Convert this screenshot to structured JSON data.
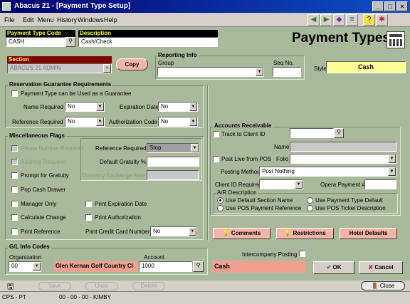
{
  "window": {
    "title": "Abacus 21 - [Payment Type Setup]",
    "min": "_",
    "max": "□",
    "close": "×"
  },
  "menu": [
    "File",
    "Edit",
    "Menu",
    "History",
    "Windows",
    "Help"
  ],
  "toolbar_icons": [
    "back-arrow-icon",
    "forward-arrow-icon",
    "diamond-icon",
    "stack-icon",
    "help-icon",
    "user-exit-icon"
  ],
  "header": {
    "payment_type_code_label": "Payment Type Code",
    "payment_type_code": "CASH",
    "description_label": "Description",
    "description": "Cash/Check",
    "big_title": "Payment Types"
  },
  "section": {
    "label": "Section",
    "value": "ABACUS 21 ADMIN",
    "copy": "Copy"
  },
  "reporting": {
    "title": "Reporting Info",
    "group_label": "Group",
    "group_value": "",
    "seq_label": "Seq No.",
    "seq_value": "",
    "style_label": "Style",
    "style_value": "Cash"
  },
  "guarantee": {
    "title": "Reservation Guarantee Requirements",
    "can_be_used": "Payment Type can be Used as a Guarantee",
    "name_required_label": "Name Required",
    "name_required": "No",
    "expiration_date_label": "Expiration Date",
    "expiration_date": "No",
    "reference_required_label": "Reference Required",
    "reference_required": "No",
    "auth_code_label": "Authorization Code",
    "auth_code": "No"
  },
  "misc": {
    "title": "Miscellaneous Flags",
    "phone_required": "Phone Number Required",
    "address_required": "Address Required",
    "prompt_gratuity": "Prompt for Gratuity",
    "pop_cash_drawer": "Pop Cash Drawer",
    "manager_only": "Manager Only",
    "calculate_change": "Calculate Change",
    "print_reference": "Print Reference",
    "reference_required_label": "Reference Required",
    "reference_required": "Stop",
    "default_gratuity_label": "Default Gratuity %",
    "default_gratuity": "",
    "currency_exchange_label": "Currency Exchange Rate",
    "currency_exchange": "",
    "print_expiration": "Print Expiration Date",
    "print_authorization": "Print Authorization",
    "print_cc_label": "Print Credit Card Number",
    "print_cc": "No"
  },
  "ar": {
    "title": "Accounts Receivable",
    "track_client": "Track to Client ID",
    "track_client_value": "",
    "name_label": "Name",
    "name_value": "",
    "post_live": "Post Live from POS",
    "folio_label": "Folio",
    "folio_value": "",
    "posting_method_label": "Posting Method",
    "posting_method": "Post Nothing",
    "client_id_required_label": "Client ID Required",
    "client_id_required": "",
    "opera_payment_label": "Opera Payment #",
    "opera_payment": "",
    "ar_desc_title": "A/R Description",
    "opt_default_section": "Use Default Section Name",
    "opt_payment_type_default": "Use Payment Type Default",
    "opt_pos_reference": "Use POS Payment Reference",
    "opt_pos_ticket": "Use POS Ticket Description"
  },
  "actions": {
    "comments": "Comments",
    "restrictions": "Restrictions",
    "hotel_defaults": "Hotel Defaults"
  },
  "gl": {
    "title": "G/L Info Codes",
    "organization_label": "Organization",
    "organization": "00",
    "org_name": "Glen Kernan Golf  Country Cl",
    "account_label": "Account",
    "account": "1000",
    "account_name": "Cash",
    "intercompany_label": "Intercompany Posting"
  },
  "buttons": {
    "ok": "OK",
    "cancel": "Cancel",
    "save": "Save",
    "undo": "Undo",
    "delete": "Delete",
    "close": "Close"
  },
  "status": {
    "left": "CPS - PT",
    "center": "00 - 00 - 00 - KIMBY"
  }
}
